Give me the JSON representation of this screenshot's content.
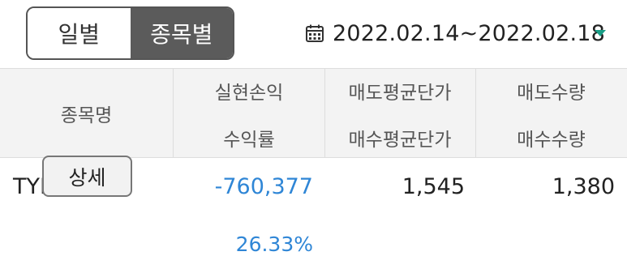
{
  "tabs": [
    {
      "label": "일별",
      "selected": false
    },
    {
      "label": "종목별",
      "selected": true
    }
  ],
  "period": {
    "icon": "calendar-icon",
    "text": "2022.02.14~2022.02.18",
    "dropdown_icon": "chevron-down-icon",
    "arrow_color": "#199e86"
  },
  "table": {
    "headers": {
      "name": "종목명",
      "col2_top": "실현손익",
      "col2_bottom": "수익률",
      "col3_top": "매도평균단가",
      "col3_bottom": "매수평균단가",
      "col4_top": "매도수량",
      "col4_bottom": "매수수량"
    },
    "rows": [
      {
        "name": "TYM",
        "detail_button": "상세",
        "realized_pl": "-760,377",
        "return_rate": "26.33%",
        "sell_avg_price": "1,545",
        "buy_avg_price": "",
        "sell_qty": "1,380",
        "buy_qty": ""
      }
    ]
  },
  "colors": {
    "accent_blue": "#2f86d6",
    "selected_tab_bg": "#5b5b5b",
    "header_bg": "#f3f3f3"
  }
}
